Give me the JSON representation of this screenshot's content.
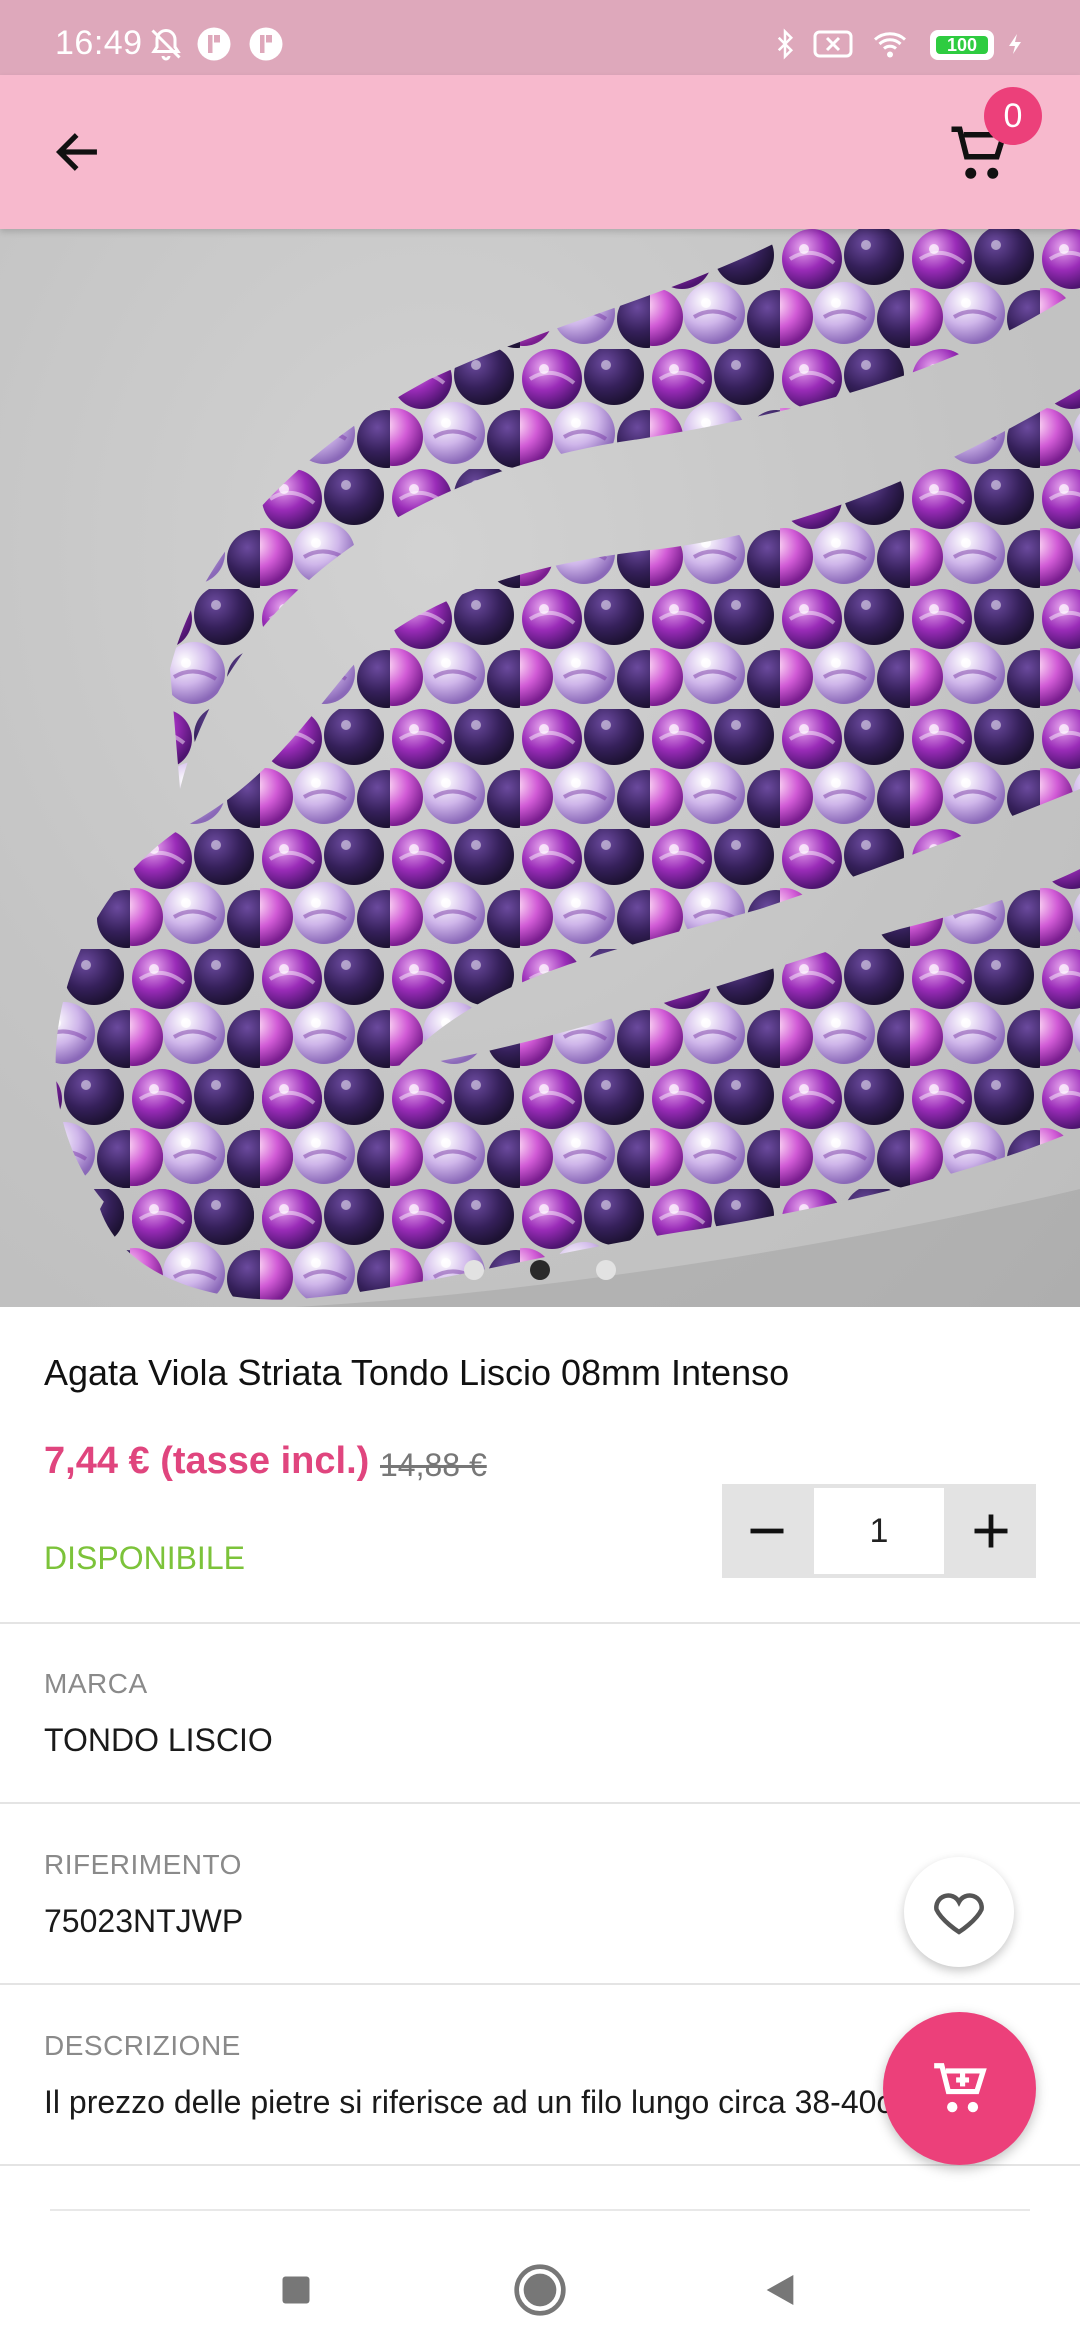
{
  "status_bar": {
    "time": "16:49",
    "battery": "100",
    "icons": [
      "bell-off-icon",
      "app-icon",
      "app-icon",
      "bluetooth-icon",
      "sim-x-icon",
      "wifi-icon",
      "battery-icon",
      "charging-icon"
    ]
  },
  "app_bar": {
    "back_icon": "arrow-left-icon",
    "cart_icon": "cart-icon",
    "cart_count": "0",
    "color": "#f7b9cd"
  },
  "gallery": {
    "image_alt": "purple striped agate round beads strands",
    "page_count": 3,
    "active_index": 1
  },
  "product": {
    "title": "Agata Viola Striata Tondo Liscio 08mm Intenso",
    "price": "7,44 € (tasse incl.)",
    "old_price": "14,88 €",
    "availability": "DISPONIBILE",
    "quantity": "1",
    "price_color": "#e0457e",
    "availability_color": "#7cc33a"
  },
  "details": [
    {
      "label": "MARCA",
      "value": "TONDO LISCIO"
    },
    {
      "label": "RIFERIMENTO",
      "value": "75023NTJWP"
    },
    {
      "label": "DESCRIZIONE",
      "value": "Il prezzo delle pietre si riferisce ad un filo lungo circa 38-40cm."
    }
  ],
  "fab": {
    "favorite_icon": "heart-outline-icon",
    "add_to_cart_icon": "add-cart-icon",
    "accent": "#ec407a"
  },
  "nav_bar": {
    "buttons": [
      "recents-icon",
      "home-icon",
      "back-icon"
    ]
  }
}
